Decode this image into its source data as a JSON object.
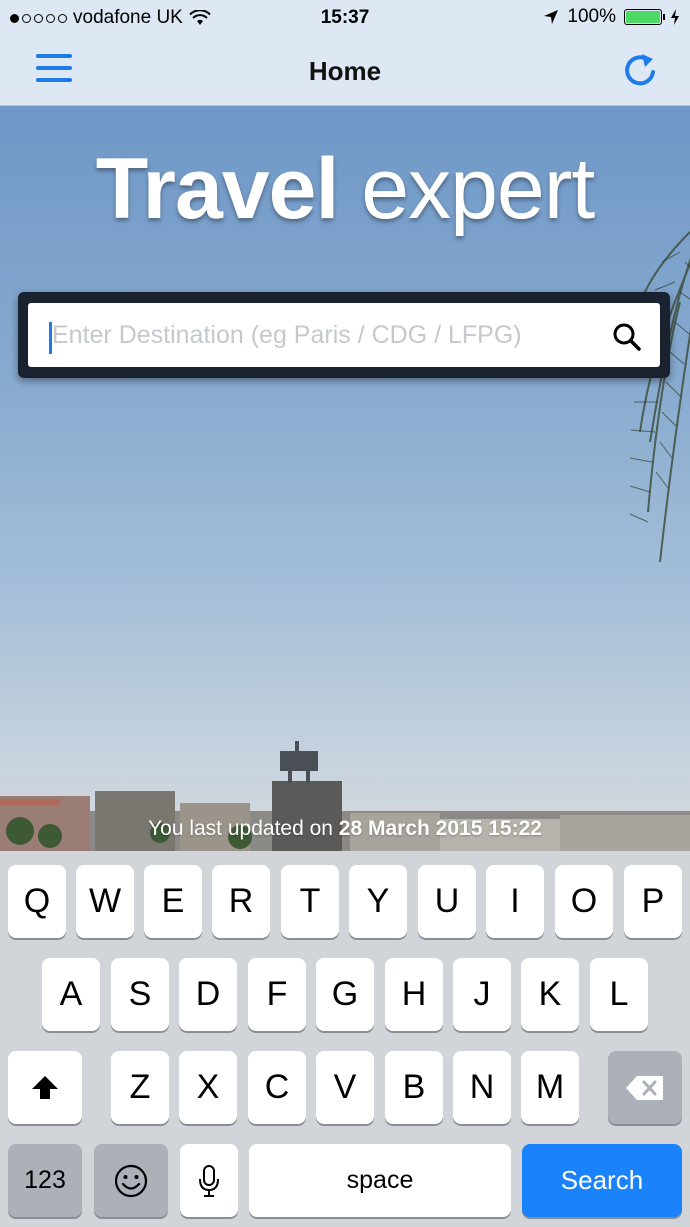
{
  "status": {
    "carrier": "vodafone UK",
    "time": "15:37",
    "battery": "100%"
  },
  "nav": {
    "title": "Home",
    "menu_icon": "hamburger-menu-icon",
    "refresh_icon": "refresh-icon"
  },
  "brand": {
    "word1": "Travel",
    "word2": "expert"
  },
  "search": {
    "placeholder": "Enter Destination (eg Paris / CDG / LFPG)",
    "value": ""
  },
  "footer": {
    "prefix": "You last updated on",
    "date": "28 March 2015 15:22"
  },
  "keyboard": {
    "row1": [
      "Q",
      "W",
      "E",
      "R",
      "T",
      "Y",
      "U",
      "I",
      "O",
      "P"
    ],
    "row2": [
      "A",
      "S",
      "D",
      "F",
      "G",
      "H",
      "J",
      "K",
      "L"
    ],
    "row3": [
      "Z",
      "X",
      "C",
      "V",
      "B",
      "N",
      "M"
    ],
    "numbers": "123",
    "space": "space",
    "action": "Search"
  },
  "colors": {
    "accent": "#1e7ce8",
    "battery": "#4cd964",
    "search_key": "#1a82fb"
  }
}
